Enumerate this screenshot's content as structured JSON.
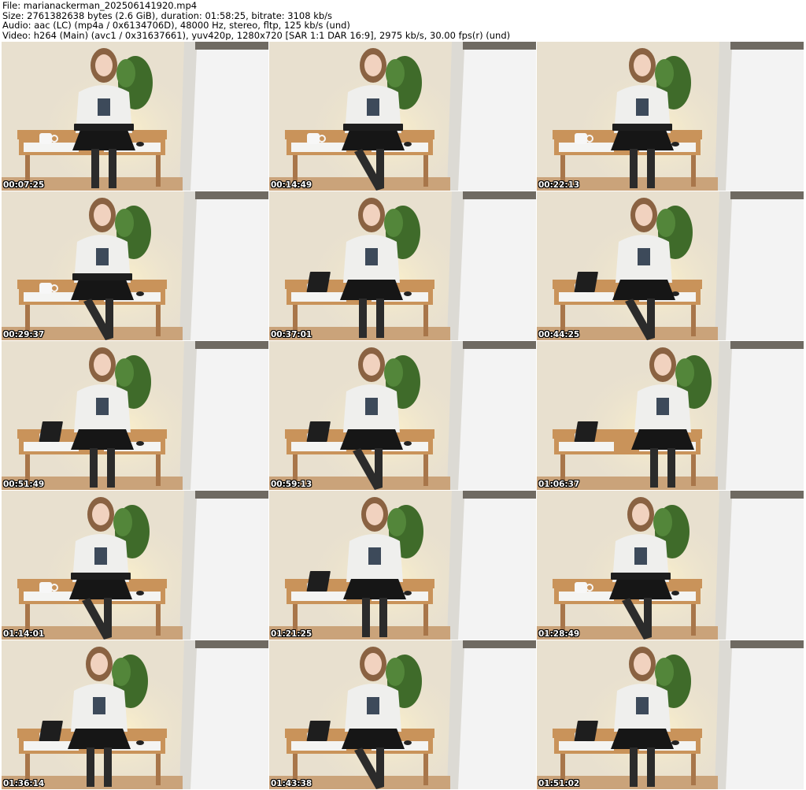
{
  "header": {
    "file_line": "File: marianackerman_202506141920.mp4",
    "size_line": "Size: 2761382638 bytes (2.6 GiB), duration: 01:58:25, bitrate: 3108 kb/s",
    "audio_line": "Audio: aac (LC) (mp4a / 0x6134706D), 48000 Hz, stereo, fltp, 125 kb/s (und)",
    "video_line": "Video: h264 (Main) (avc1 / 0x31637661), yuv420p, 1280x720 [SAR 1:1 DAR 16:9], 2975 kb/s, 30.00 fps(r) (und)"
  },
  "grid": {
    "columns": 3,
    "rows": 5
  },
  "thumbnails": [
    {
      "timestamp": "00:07:25"
    },
    {
      "timestamp": "00:14:49"
    },
    {
      "timestamp": "00:22:13"
    },
    {
      "timestamp": "00:29:37"
    },
    {
      "timestamp": "00:37:01"
    },
    {
      "timestamp": "00:44:25"
    },
    {
      "timestamp": "00:51:49"
    },
    {
      "timestamp": "00:59:13"
    },
    {
      "timestamp": "01:06:37"
    },
    {
      "timestamp": "01:14:01"
    },
    {
      "timestamp": "01:21:25"
    },
    {
      "timestamp": "01:28:49"
    },
    {
      "timestamp": "01:36:14"
    },
    {
      "timestamp": "01:43:38"
    },
    {
      "timestamp": "01:51:02"
    }
  ],
  "colors": {
    "wall": "#e8e0cf",
    "desk_wood": "#c9935a",
    "desk_drawer": "#f4f4f2",
    "sweater": "#efefed",
    "skirt": "#161616",
    "hair": "#8a6242",
    "plant": "#3f6b2a",
    "panel": "#f3f3f3"
  }
}
